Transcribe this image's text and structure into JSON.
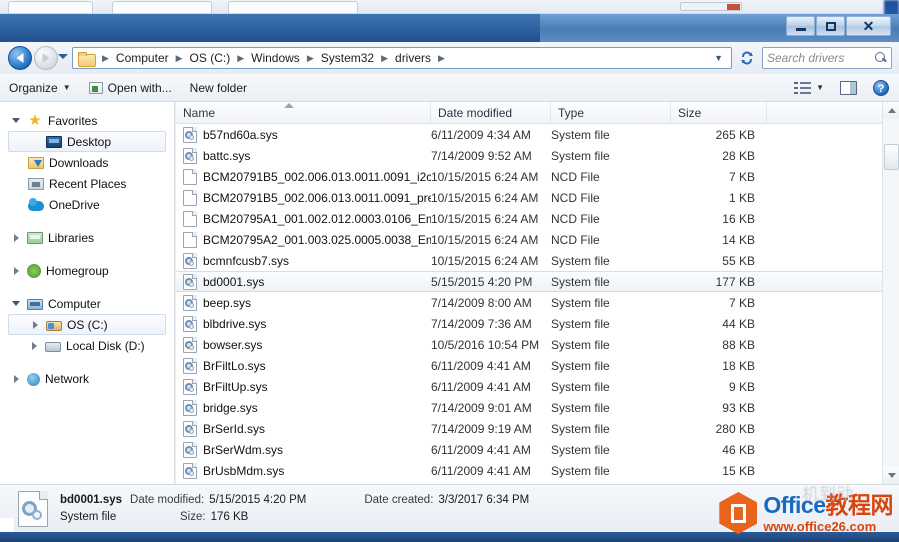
{
  "window": {
    "buttons": {
      "minimize": "–",
      "maximize": "□",
      "close": "✕"
    }
  },
  "address": {
    "folder_icon": "folder-icon",
    "breadcrumbs": [
      "Computer",
      "OS (C:)",
      "Windows",
      "System32",
      "drivers"
    ],
    "separator": "▶",
    "dropdown": "▼",
    "refresh": "↻"
  },
  "search": {
    "placeholder": "Search drivers",
    "icon": "search-icon"
  },
  "toolbar": {
    "organize": "Organize",
    "organize_caret": "▼",
    "open_with": "Open with...",
    "new_folder": "New folder",
    "view_icon": "view-layout-icon",
    "view_caret": "▼",
    "preview_pane_icon": "preview-pane-icon",
    "help": "?"
  },
  "sidebar": {
    "groups": [
      {
        "label": "Favorites",
        "icon": "star-icon",
        "expander": "open",
        "items": [
          {
            "label": "Desktop",
            "icon": "desktop-icon",
            "selected": true
          },
          {
            "label": "Downloads",
            "icon": "downloads-icon",
            "selected": false
          },
          {
            "label": "Recent Places",
            "icon": "recent-places-icon",
            "selected": false
          },
          {
            "label": "OneDrive",
            "icon": "onedrive-icon",
            "selected": false
          }
        ]
      },
      {
        "label": "Libraries",
        "icon": "libraries-icon",
        "expander": "closed",
        "items": []
      },
      {
        "label": "Homegroup",
        "icon": "homegroup-icon",
        "expander": "closed",
        "items": []
      },
      {
        "label": "Computer",
        "icon": "computer-icon",
        "expander": "open",
        "items": [
          {
            "label": "OS (C:)",
            "icon": "os-drive-icon",
            "selected": true
          },
          {
            "label": "Local Disk (D:)",
            "icon": "local-disk-icon",
            "selected": false
          }
        ]
      },
      {
        "label": "Network",
        "icon": "network-icon",
        "expander": "closed",
        "items": []
      }
    ]
  },
  "filelist": {
    "columns": [
      "Name",
      "Date modified",
      "Type",
      "Size"
    ],
    "sort_column": "Name",
    "sort_direction": "ascending",
    "rows": [
      {
        "name": "b57nd60a.sys",
        "date": "6/11/2009 4:34 AM",
        "type": "System file",
        "size": "265 KB",
        "icon": "system-file-icon",
        "selected": false
      },
      {
        "name": "battc.sys",
        "date": "7/14/2009 9:52 AM",
        "type": "System file",
        "size": "28 KB",
        "icon": "system-file-icon",
        "selected": false
      },
      {
        "name": "BCM20791B5_002.006.013.0011.0091_i2c....",
        "date": "10/15/2015 6:24 AM",
        "type": "NCD File",
        "size": "7 KB",
        "icon": "generic-file-icon",
        "selected": false
      },
      {
        "name": "BCM20791B5_002.006.013.0011.0091_pre....",
        "date": "10/15/2015 6:24 AM",
        "type": "NCD File",
        "size": "1 KB",
        "icon": "generic-file-icon",
        "selected": false
      },
      {
        "name": "BCM20795A1_001.002.012.0003.0106_Em...",
        "date": "10/15/2015 6:24 AM",
        "type": "NCD File",
        "size": "16 KB",
        "icon": "generic-file-icon",
        "selected": false
      },
      {
        "name": "BCM20795A2_001.003.025.0005.0038_Em...",
        "date": "10/15/2015 6:24 AM",
        "type": "NCD File",
        "size": "14 KB",
        "icon": "generic-file-icon",
        "selected": false
      },
      {
        "name": "bcmnfcusb7.sys",
        "date": "10/15/2015 6:24 AM",
        "type": "System file",
        "size": "55 KB",
        "icon": "system-file-icon",
        "selected": false
      },
      {
        "name": "bd0001.sys",
        "date": "5/15/2015 4:20 PM",
        "type": "System file",
        "size": "177 KB",
        "icon": "system-file-icon",
        "selected": true
      },
      {
        "name": "beep.sys",
        "date": "7/14/2009 8:00 AM",
        "type": "System file",
        "size": "7 KB",
        "icon": "system-file-icon",
        "selected": false
      },
      {
        "name": "blbdrive.sys",
        "date": "7/14/2009 7:36 AM",
        "type": "System file",
        "size": "44 KB",
        "icon": "system-file-icon",
        "selected": false
      },
      {
        "name": "bowser.sys",
        "date": "10/5/2016 10:54 PM",
        "type": "System file",
        "size": "88 KB",
        "icon": "system-file-icon",
        "selected": false
      },
      {
        "name": "BrFiltLo.sys",
        "date": "6/11/2009 4:41 AM",
        "type": "System file",
        "size": "18 KB",
        "icon": "system-file-icon",
        "selected": false
      },
      {
        "name": "BrFiltUp.sys",
        "date": "6/11/2009 4:41 AM",
        "type": "System file",
        "size": "9 KB",
        "icon": "system-file-icon",
        "selected": false
      },
      {
        "name": "bridge.sys",
        "date": "7/14/2009 9:01 AM",
        "type": "System file",
        "size": "93 KB",
        "icon": "system-file-icon",
        "selected": false
      },
      {
        "name": "BrSerId.sys",
        "date": "7/14/2009 9:19 AM",
        "type": "System file",
        "size": "280 KB",
        "icon": "system-file-icon",
        "selected": false
      },
      {
        "name": "BrSerWdm.sys",
        "date": "6/11/2009 4:41 AM",
        "type": "System file",
        "size": "46 KB",
        "icon": "system-file-icon",
        "selected": false
      },
      {
        "name": "BrUsbMdm.sys",
        "date": "6/11/2009 4:41 AM",
        "type": "System file",
        "size": "15 KB",
        "icon": "system-file-icon",
        "selected": false
      }
    ]
  },
  "details": {
    "icon": "system-file-icon",
    "name": "bd0001.sys",
    "date_modified_label": "Date modified:",
    "date_modified_value": "5/15/2015 4:20 PM",
    "date_created_label": "Date created:",
    "date_created_value": "3/3/2017 6:34 PM",
    "type": "System file",
    "size_label": "Size:",
    "size_value": "176 KB"
  },
  "watermark": {
    "logo": "office-logo-icon",
    "title_en": "Office",
    "title_cn": "教程网",
    "url": "www.office26.com",
    "ghost_text": "机到动"
  },
  "colors": {
    "title_blue": "#2f63a4",
    "accent_blue": "#1669c1",
    "watermark_orange": "#d6470f",
    "selection_bg": "#eef2f7"
  }
}
